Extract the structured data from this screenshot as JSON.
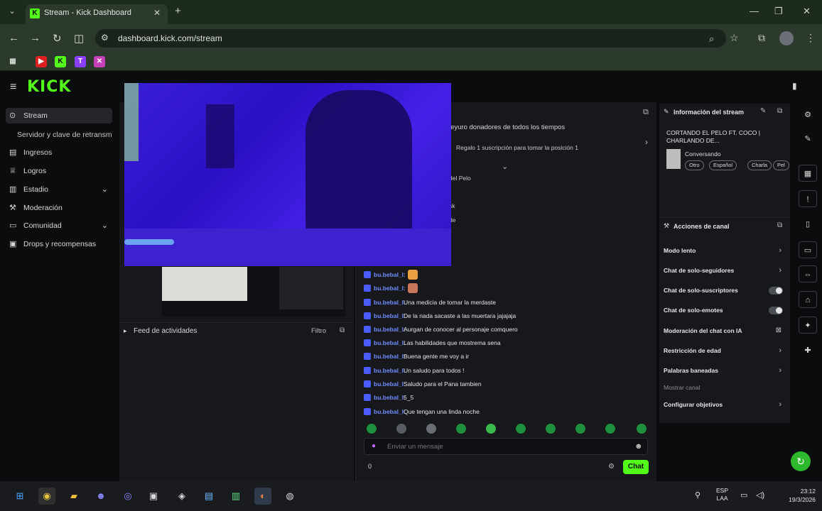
{
  "browser": {
    "tab_title": "Stream - Kick Dashboard",
    "url": "dashboard.kick.com/stream",
    "tab_menu_icon": "chevron-down-icon",
    "colors": {
      "chrome": "#2b3a2c",
      "kick_green": "#53fc18"
    }
  },
  "kick": {
    "logo": "KICK",
    "sidebar": {
      "items": [
        {
          "label": "Stream",
          "icon": "stream-icon"
        },
        {
          "label": "Servidor y clave de retransm",
          "icon": ""
        },
        {
          "label": "Ingresos",
          "icon": "money-icon"
        },
        {
          "label": "Logros",
          "icon": "trophy-icon"
        },
        {
          "label": "Estadio",
          "icon": "stats-icon"
        },
        {
          "label": "Moderación",
          "icon": "hammer-icon"
        },
        {
          "label": "Comunidad",
          "icon": "community-icon"
        },
        {
          "label": "Drops y recompensas",
          "icon": "gift-icon"
        }
      ]
    },
    "feed": {
      "title": "Feed de actividades",
      "filter": "Filtro"
    },
    "chat": {
      "pinned_1": "jeyuro donadores de todos los tiempos",
      "pinned_2": "Regalo 1 suscripción para tomar la posición 1",
      "snip_1": "del Pelo",
      "snip_2": "sk",
      "snip_3": "de",
      "messages": [
        {
          "user": "bu.bebal_l:",
          "text": ""
        },
        {
          "user": "bu.bebal_l:",
          "text": ""
        },
        {
          "user": "bu.bebal_l:",
          "text": "Una medicia de tomar la merdaste"
        },
        {
          "user": "bu.bebal_l:",
          "text": "De la nada sacaste a las muertara jajajaja"
        },
        {
          "user": "bu.bebal_l:",
          "text": "Aurgan de conocer al personaje comquero"
        },
        {
          "user": "bu.bebal_l:",
          "text": "Las habilidades que mostrema sena"
        },
        {
          "user": "bu.bebal_l:",
          "text": "Buena gente me voy a ir"
        },
        {
          "user": "bu.bebal_l:",
          "text": "Un saludo para todos !"
        },
        {
          "user": "bu.bebal_l:",
          "text": "Saludo para el Pana tambien"
        },
        {
          "user": "bu.bebal_l:",
          "text": "5_5"
        },
        {
          "user": "bu.bebal_l:",
          "text": "Que tengan una linda noche"
        }
      ],
      "input_placeholder": "Enviar un mensaje",
      "viewer_count": "0",
      "send_label": "Chat"
    },
    "stream_info": {
      "header": "Información del stream",
      "title": "CORTANDO EL PELO FT. COCO | CHARLANDO DE...",
      "category": "Conversando",
      "tags": [
        "Otro",
        "Español",
        "Charla",
        "Pel"
      ]
    },
    "channel_actions": {
      "header": "Acciones de canal",
      "items": [
        {
          "label": "Modo lento",
          "control": "chevron"
        },
        {
          "label": "Chat de solo-seguidores",
          "control": "chevron"
        },
        {
          "label": "Chat de solo-suscriptores",
          "control": "toggle"
        },
        {
          "label": "Chat de solo-emotes",
          "control": "toggle"
        },
        {
          "label": "Moderación del chat con IA",
          "control": "ai"
        },
        {
          "label": "Restricción de edad",
          "control": "chevron"
        },
        {
          "label": "Palabras baneadas",
          "control": "chevron"
        },
        {
          "label": "Mostrar canal",
          "control": "muted"
        },
        {
          "label": "Configurar objetivos",
          "control": "chevron"
        }
      ]
    }
  },
  "taskbar": {
    "lang": "ESP\nLAA",
    "time": "23:12",
    "date": "19/3/2026"
  }
}
